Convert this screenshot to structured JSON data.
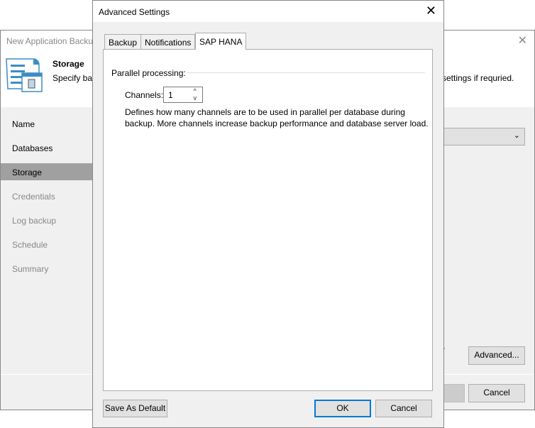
{
  "background_window": {
    "title": "New Application Backup Job",
    "header_title": "Storage",
    "header_desc_left": "Specify backup",
    "header_desc_right": "settings if requried.",
    "nav": [
      {
        "label": "Name",
        "state": "done"
      },
      {
        "label": "Databases",
        "state": "done"
      },
      {
        "label": "Storage",
        "state": "selected"
      },
      {
        "label": "Credentials",
        "state": "disabled"
      },
      {
        "label": "Log backup",
        "state": "disabled"
      },
      {
        "label": "Schedule",
        "state": "disabled"
      },
      {
        "label": "Summary",
        "state": "disabled"
      }
    ],
    "partial_text": "r",
    "advanced_label": "Advanced...",
    "cancel_label": "Cancel"
  },
  "dialog": {
    "title": "Advanced Settings",
    "tabs": [
      {
        "label": "Backup"
      },
      {
        "label": "Notifications"
      },
      {
        "label": "SAP HANA",
        "active": true
      }
    ],
    "section": "Parallel processing:",
    "channels_label": "Channels:",
    "channels_value": "1",
    "description": "Defines how many channels are to be used in parallel per database during backup. More channels increase backup performance and database server load.",
    "save_default_label": "Save As Default",
    "ok_label": "OK",
    "cancel_label": "Cancel"
  }
}
